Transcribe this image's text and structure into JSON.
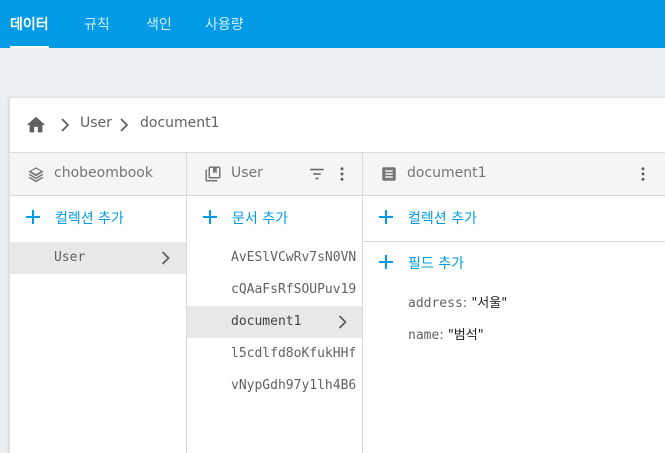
{
  "tabs": [
    {
      "label": "데이터"
    },
    {
      "label": "규칙"
    },
    {
      "label": "색인"
    },
    {
      "label": "사용량"
    }
  ],
  "breadcrumb": {
    "items": [
      "User",
      "document1"
    ]
  },
  "columns": {
    "root": {
      "title": "chobeombook",
      "add_label": "컬렉션 추가",
      "items": [
        {
          "label": "User"
        }
      ]
    },
    "collection": {
      "title": "User",
      "add_label": "문서 추가",
      "items": [
        {
          "label": "AvESlVCwRv7sN0VN"
        },
        {
          "label": "cQAaFsRfSOUPuv19"
        },
        {
          "label": "document1"
        },
        {
          "label": "l5cdlfd8oKfukHHf"
        },
        {
          "label": "vNypGdh97y1lh4B6"
        }
      ]
    },
    "document": {
      "title": "document1",
      "add_collection_label": "컬렉션 추가",
      "add_field_label": "필드 추가",
      "fields": [
        {
          "key": "address",
          "value": "\"서울\""
        },
        {
          "key": "name",
          "value": "\"범석\""
        }
      ]
    }
  },
  "colors": {
    "accent": "#039be5",
    "selected_row": "#e8e8e8",
    "header_bg": "#f5f5f5"
  }
}
